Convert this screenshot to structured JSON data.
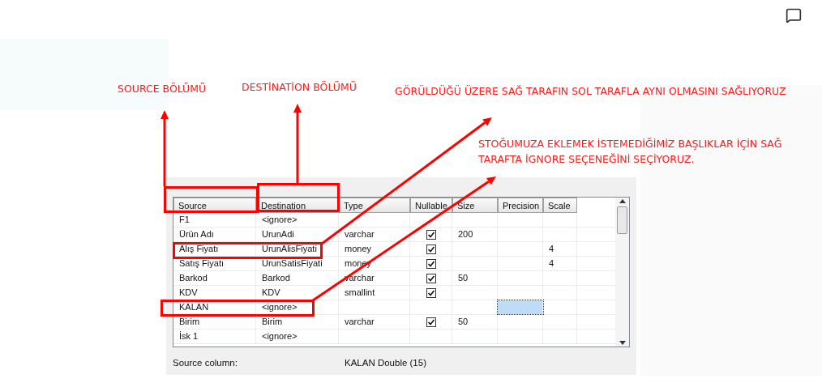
{
  "dialog": {
    "columns": [
      "Source",
      "Destination",
      "Type",
      "Nullable",
      "Size",
      "Precision",
      "Scale"
    ],
    "rows": [
      {
        "source": "F1",
        "destination": "<ignore>",
        "type": "",
        "nullable": false,
        "size": "",
        "precision": "",
        "scale": "",
        "precision_focused": false
      },
      {
        "source": "Ürün Adı",
        "destination": "UrunAdi",
        "type": "varchar",
        "nullable": true,
        "size": "200",
        "precision": "",
        "scale": "",
        "precision_focused": false
      },
      {
        "source": "Alış Fiyatı",
        "destination": "UrunAlisFiyati",
        "type": "money",
        "nullable": true,
        "size": "",
        "precision": "",
        "scale": "4",
        "precision_focused": false
      },
      {
        "source": "Satış Fiyatı",
        "destination": "UrunSatisFiyati",
        "type": "money",
        "nullable": true,
        "size": "",
        "precision": "",
        "scale": "4",
        "precision_focused": false
      },
      {
        "source": "Barkod",
        "destination": "Barkod",
        "type": "varchar",
        "nullable": true,
        "size": "50",
        "precision": "",
        "scale": "",
        "precision_focused": false
      },
      {
        "source": "KDV",
        "destination": "KDV",
        "type": "smallint",
        "nullable": true,
        "size": "",
        "precision": "",
        "scale": "",
        "precision_focused": false
      },
      {
        "source": "KALAN",
        "destination": "<ignore>",
        "type": "",
        "nullable": false,
        "size": "",
        "precision": "",
        "scale": "",
        "precision_focused": true
      },
      {
        "source": "Birim",
        "destination": "Birim",
        "type": "varchar",
        "nullable": true,
        "size": "50",
        "precision": "",
        "scale": "",
        "precision_focused": false
      },
      {
        "source": "İsk 1",
        "destination": "<ignore>",
        "type": "",
        "nullable": false,
        "size": "",
        "precision": "",
        "scale": "",
        "precision_focused": false
      }
    ],
    "source_column_label": "Source column:",
    "source_column_value": "KALAN Double (15)"
  },
  "annotations": [
    {
      "text": "SOURCE BÖLÜMÜ"
    },
    {
      "text": "DESTİNATİON BÖLÜMÜ"
    },
    {
      "text": "GÖRÜLDÜĞÜ ÜZERE SAĞ TARAFIN SOL TARAFLA AYNI OLMASINI SAĞLIYORUZ"
    },
    {
      "text": "STOĞUMUZA EKLEMEK İSTEMEDİĞİMİZ BAŞLIKLAR İÇİN SAĞ TARAFTA İGNORE SEÇENEĞİNİ SEÇİYORUZ."
    }
  ]
}
